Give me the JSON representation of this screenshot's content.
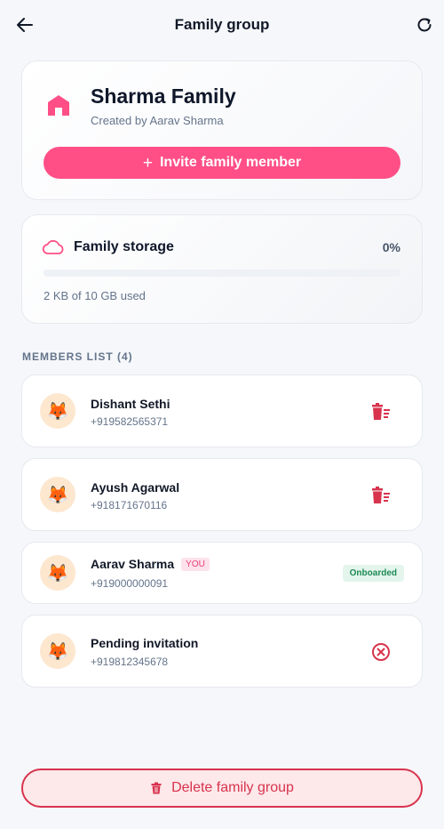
{
  "header": {
    "title": "Family group",
    "back_icon": "arrow-left-icon",
    "refresh_icon": "refresh-icon"
  },
  "family": {
    "name": "Sharma Family",
    "creator": "Created by Aarav Sharma",
    "invite_label": "Invite family member",
    "invite_icon": "plus-icon",
    "home_icon": "home-icon"
  },
  "storage": {
    "label": "Family storage",
    "percent_text": "0%",
    "used_text": "2 KB of 10 GB used",
    "usage_fraction": 0.0,
    "cloud_icon": "cloud-icon"
  },
  "members_title": "MEMBERS LIST (4)",
  "members": [
    {
      "name": "Dishant Sethi",
      "phone": "+919582565371",
      "avatar": "🦊",
      "action": "delete-member-icon"
    },
    {
      "name": "Ayush Agarwal",
      "phone": "+918171670116",
      "avatar": "🦊",
      "action": "delete-member-icon"
    },
    {
      "name": "Aarav Sharma",
      "you_badge": "YOU",
      "phone": "+919000000091",
      "avatar": "🦊",
      "status": "Onboarded"
    },
    {
      "name": "Pending invitation",
      "phone": "+919812345678",
      "avatar": "🦊",
      "action": "cancel-invite-icon"
    }
  ],
  "delete_group_label": "Delete family group",
  "colors": {
    "accent": "#ff4f86",
    "danger": "#d8334d",
    "success": "#1d8a55"
  }
}
